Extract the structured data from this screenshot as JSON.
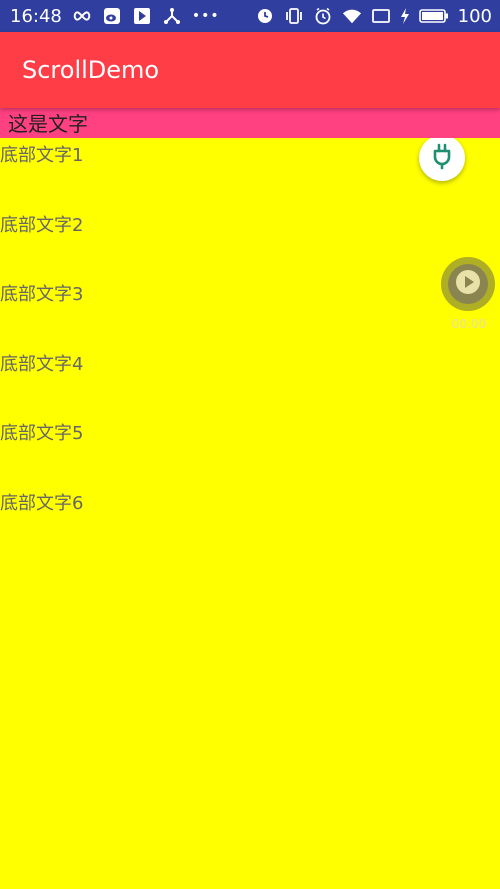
{
  "status_bar": {
    "time": "16:48",
    "battery_level": "100",
    "icons_left": [
      "infinity-icon",
      "weibo-icon",
      "play-store-icon",
      "share-icon",
      "more-icon"
    ],
    "icons_right": [
      "alarm-icon",
      "vibrate-icon",
      "clock-icon",
      "wifi-icon",
      "signal-icon",
      "charging-icon",
      "battery-icon"
    ],
    "more": "•••"
  },
  "app_bar": {
    "title": "ScrollDemo",
    "color": "#ff3d47"
  },
  "header_strip": {
    "text": "这是文字",
    "color": "#ff4081"
  },
  "list": {
    "background": "#ffff00",
    "items": [
      {
        "label": "底部文字1"
      },
      {
        "label": "底部文字2"
      },
      {
        "label": "底部文字3"
      },
      {
        "label": "底部文字4"
      },
      {
        "label": "底部文字5"
      },
      {
        "label": "底部文字6"
      }
    ]
  },
  "floating": {
    "plugin_icon": "plug-icon",
    "player_icon": "play-icon",
    "player_time": "00:00"
  }
}
